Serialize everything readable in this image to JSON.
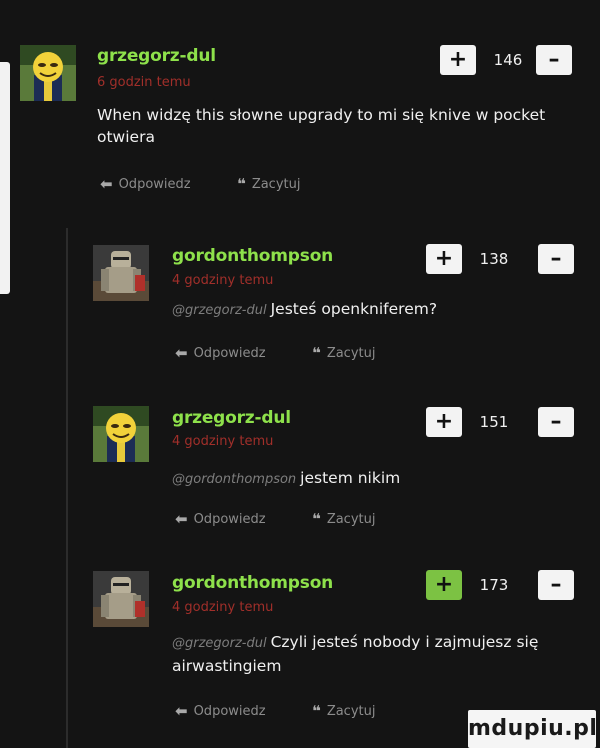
{
  "comments": [
    {
      "username": "grzegorz-dul",
      "time": "6 godzin temu",
      "mention": "",
      "text": "When widzę this słowne upgrady to mi się knive w pocket otwiera",
      "score": "146",
      "upvote_active": false,
      "avatar_icon": "emoji-face-avatar-icon"
    },
    {
      "username": "gordonthompson",
      "time": "4 godziny temu",
      "mention": "@grzegorz-dul",
      "text": "Jesteś openkniferem?",
      "score": "138",
      "upvote_active": false,
      "avatar_icon": "knight-armor-avatar-icon"
    },
    {
      "username": "grzegorz-dul",
      "time": "4 godziny temu",
      "mention": "@gordonthompson",
      "text": "jestem nikim",
      "score": "151",
      "upvote_active": false,
      "avatar_icon": "emoji-face-avatar-icon"
    },
    {
      "username": "gordonthompson",
      "time": "4 godziny temu",
      "mention": "@grzegorz-dul",
      "text": "Czyli jesteś nobody i zajmujesz się airwastingiem",
      "score": "173",
      "upvote_active": true,
      "avatar_icon": "knight-armor-avatar-icon"
    }
  ],
  "actions": {
    "reply_label": "Odpowiedz",
    "quote_label": "Zacytuj",
    "reply_icon": "reply-arrow-icon",
    "quote_icon": "quote-icon"
  },
  "vote_labels": {
    "plus": "+",
    "minus": "–"
  },
  "watermark": "mdupiu.pl",
  "colors": {
    "background": "#141414",
    "username": "#8ee14b",
    "time": "#a12f2a",
    "upvote_active": "#7cc243"
  }
}
